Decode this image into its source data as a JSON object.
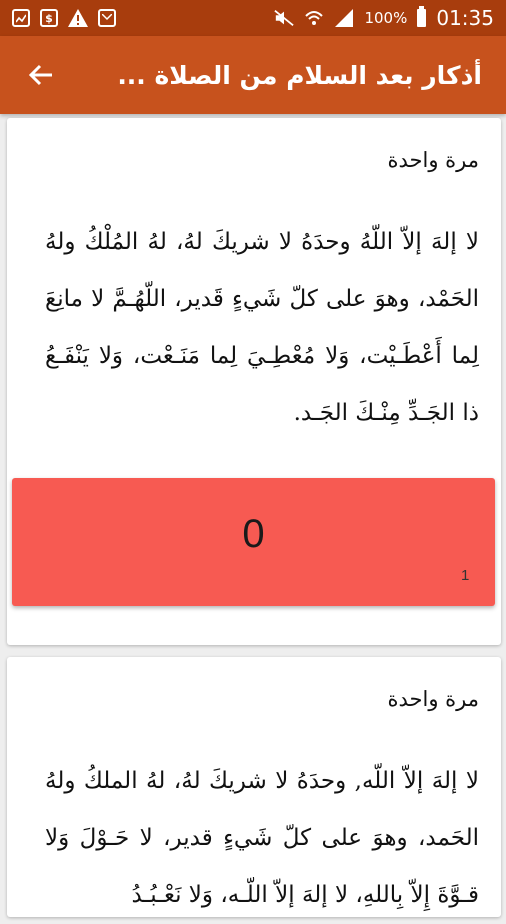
{
  "status_bar": {
    "battery_percent": "100%",
    "time": "01:35",
    "icons_left": [
      "gallery-icon",
      "dollar-icon",
      "warning-icon",
      "mail-icon"
    ],
    "icons_right": [
      "mute-icon",
      "wifi-icon",
      "signal-icon",
      "battery-icon"
    ]
  },
  "app_bar": {
    "title": "أذكار بعد السلام من الصلاة ...",
    "back_icon": "arrow-back-icon",
    "colors": {
      "app_bar": "#c7521d",
      "status_bar": "#a83d0d"
    }
  },
  "items": [
    {
      "count_label": "مرة واحدة",
      "text": "لا إلهَ إلاّ اللّهُ وحدَهُ لا شريكَ لهُ، لهُ المُلْكُ ولهُ الحَمْد، وهوَ على كلّ شَيءٍ قَدير، اللّهُـمَّ لا مانِعَ لِما أَعْطَـيْت، وَلا مُعْطِـيَ لِما مَنَـعْت، وَلا يَنْفَـعُ ذا الجَـدِّ مِنْـكَ الجَـد.",
      "counter_value": "0",
      "counter_target": "1",
      "counter_color": "#f75a52"
    },
    {
      "count_label": "مرة واحدة",
      "text": "لا إلهَ إلاّ اللّه, وحدَهُ لا شريكَ لهُ، لهُ الملكُ ولهُ الحَمد، وهوَ على كلّ شَيءٍ قدير، لا حَـوْلَ وَلا قـوَّةَ إِلاّ بِاللهِ، لا إلهَ إلاّ اللّـه، وَلا نَعْـبُـدُ"
    }
  ]
}
